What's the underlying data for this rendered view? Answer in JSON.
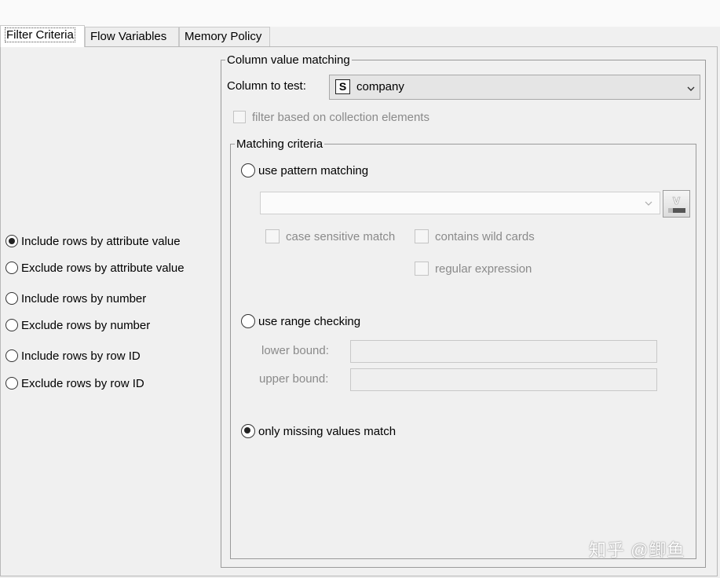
{
  "tabs": [
    {
      "label": "Filter Criteria",
      "active": true
    },
    {
      "label": "Flow Variables",
      "active": false
    },
    {
      "label": "Memory Policy",
      "active": false
    }
  ],
  "filter_modes": [
    {
      "label": "Include rows by attribute value",
      "checked": true
    },
    {
      "label": "Exclude rows by attribute value",
      "checked": false
    },
    {
      "label": "Include rows by number",
      "checked": false
    },
    {
      "label": "Exclude rows by number",
      "checked": false
    },
    {
      "label": "Include rows by row ID",
      "checked": false
    },
    {
      "label": "Exclude rows by row ID",
      "checked": false
    }
  ],
  "column_matching": {
    "legend": "Column value matching",
    "column_label": "Column to test:",
    "column_type_badge": "S",
    "column_value": "company",
    "collection_checkbox_label": "filter based on collection elements",
    "collection_checked": false
  },
  "matching_criteria": {
    "legend": "Matching criteria",
    "pattern_radio_label": "use pattern matching",
    "pattern_checked": false,
    "pattern_value": "",
    "variable_button_glyph": "V",
    "case_sensitive_label": "case sensitive match",
    "wild_cards_label": "contains wild cards",
    "regex_label": "regular expression",
    "range_radio_label": "use range checking",
    "range_checked": false,
    "lower_bound_label": "lower bound:",
    "lower_bound_value": "",
    "upper_bound_label": "upper bound:",
    "upper_bound_value": "",
    "missing_radio_label": "only missing values match",
    "missing_checked": true
  },
  "watermark": "知乎 @鲫鱼",
  "icons": {
    "dropdown": "chevron-down-icon",
    "variable": "flow-variable-icon",
    "radio": "radio-icon",
    "checkbox": "checkbox-icon"
  },
  "colors": {
    "window_bg": "#f0f0f0",
    "disabled_text": "#8a8a8a"
  }
}
